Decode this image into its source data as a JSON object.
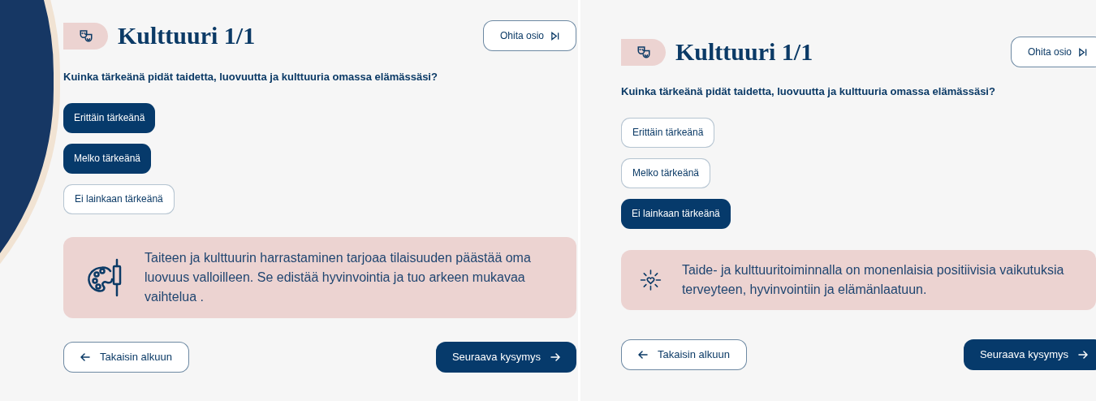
{
  "panels": [
    {
      "kind": "arc",
      "title": "Kulttuuri 1/1",
      "skip_button": "Ohita osio",
      "question": "Kuinka tärkeänä pidät taidetta, luovuutta ja kulttuuria omassa elämässäsi?",
      "options": [
        {
          "label": "Erittäin tärkeänä",
          "selected": true
        },
        {
          "label": "Melko tärkeänä",
          "selected": true
        },
        {
          "label": "Ei lainkaan tärkeänä",
          "selected": false
        }
      ],
      "info": {
        "kind": "palette",
        "text": "Taiteen ja kulttuurin harrastaminen tarjoaa tilaisuuden päästää oma luovuus valloilleen. Se edistää hyvinvointia  ja tuo arkeen mukavaa vaihtelua ."
      },
      "back_button": "Takaisin alkuun",
      "next_button": "Seuraava kysymys"
    },
    {
      "kind": "plain",
      "title": "Kulttuuri 1/1",
      "skip_button": "Ohita osio",
      "question": "Kuinka tärkeänä pidät taidetta, luovuutta ja kulttuuria omassa elämässäsi?",
      "options": [
        {
          "label": "Erittäin tärkeänä",
          "selected": false
        },
        {
          "label": "Melko tärkeänä",
          "selected": false
        },
        {
          "label": "Ei lainkaan tärkeänä",
          "selected": true
        }
      ],
      "info": {
        "kind": "heart",
        "text": "Taide- ja kulttuuritoiminnalla on monenlaisia positiivisia vaikutuksia terveyteen, hyvinvointiin ja elämänlaatuun."
      },
      "back_button": "Takaisin alkuun",
      "next_button": "Seuraava kysymys"
    }
  ]
}
